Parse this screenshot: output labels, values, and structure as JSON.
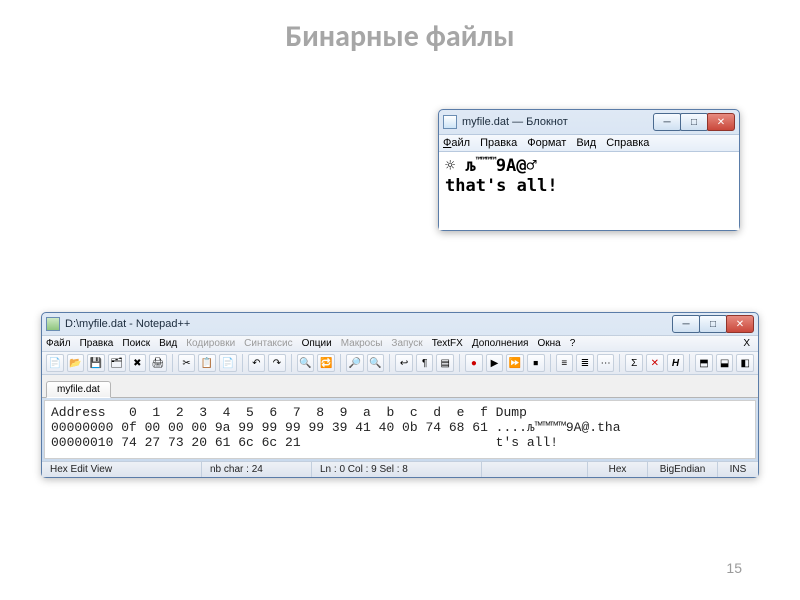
{
  "slide": {
    "title": "Бинарные файлы",
    "page_number": "15"
  },
  "notepad": {
    "title": "myfile.dat — Блокнот",
    "menus": {
      "file": "Файл",
      "edit": "Правка",
      "format": "Формат",
      "view": "Вид",
      "help": "Справка"
    },
    "line1_pre": "☼    љ",
    "line1_sup": "™™™™",
    "line1_post": "9A@♂",
    "line2": "that's all!"
  },
  "npp": {
    "title": "D:\\myfile.dat - Notepad++",
    "menus": {
      "file": "Файл",
      "edit": "Правка",
      "search": "Поиск",
      "view": "Вид",
      "encoding": "Кодировки",
      "syntax": "Синтаксис",
      "options": "Опции",
      "macros": "Макросы",
      "run": "Запуск",
      "textfx": "TextFX",
      "plugins": "Дополнения",
      "windows": "Окна",
      "help": "?"
    },
    "tab": "myfile.dat",
    "hex_header": "Address   0  1  2  3  4  5  6  7  8  9  a  b  c  d  e  f Dump",
    "hex_row1": "00000000 0f 00 00 00 9a 99 99 99 99 39 41 40 0b 74 68 61 ....љ™™™™9A@.tha",
    "hex_row2": "00000010 74 27 73 20 61 6c 6c 21                         t's all!",
    "status": {
      "view": "Hex Edit View",
      "nbchar": "nb char : 24",
      "pos": "Ln : 0   Col : 9   Sel : 8",
      "mode": "Hex",
      "endian": "BigEndian",
      "ins": "INS"
    }
  }
}
